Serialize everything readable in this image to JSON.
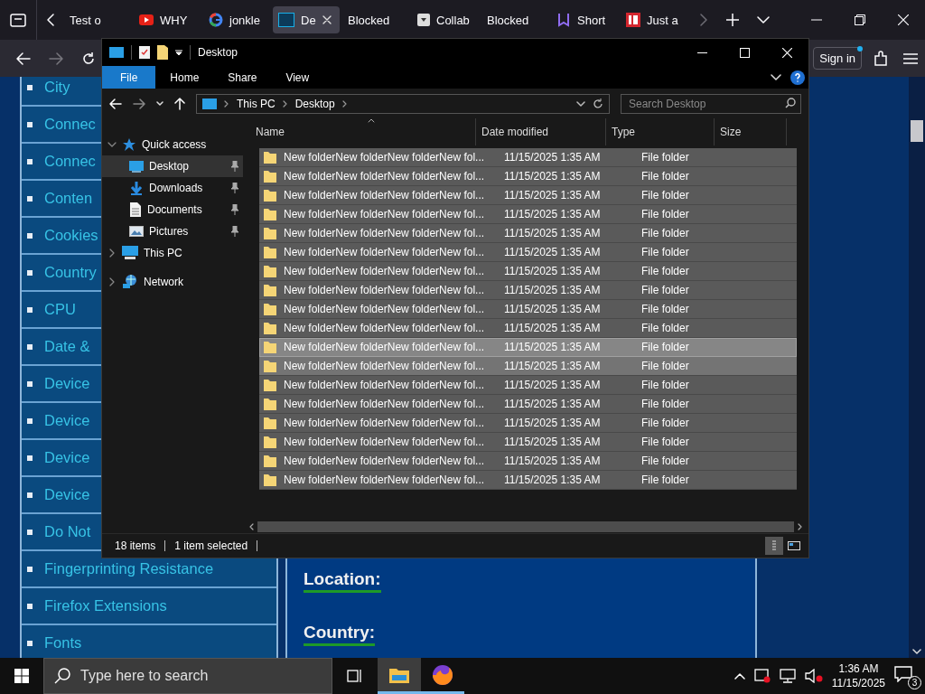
{
  "browser": {
    "tabs": [
      {
        "title": "Test o",
        "kind": "none",
        "selected": false
      },
      {
        "title": "WHY",
        "kind": "video",
        "selected": false
      },
      {
        "title": "jonkle",
        "kind": "google",
        "selected": false
      },
      {
        "title": "De",
        "kind": "square-blue",
        "selected": true
      },
      {
        "title": "Blocked",
        "kind": "none",
        "selected": false
      },
      {
        "title": "Collab",
        "kind": "download",
        "selected": false
      },
      {
        "title": "Blocked",
        "kind": "none",
        "selected": false
      },
      {
        "title": "Short",
        "kind": "bookmark",
        "selected": false
      },
      {
        "title": "Just a",
        "kind": "square-red",
        "selected": false
      }
    ],
    "sign_in": "Sign in",
    "page": {
      "sidebar_items": [
        "City",
        "Connec",
        "Connec",
        "Conten",
        "Cookies",
        "Country",
        "CPU",
        "Date &",
        "Device",
        "Device",
        "Device",
        "Device",
        "Do Not",
        "Fingerprinting Resistance",
        "Firefox Extensions",
        "Fonts"
      ],
      "headings": [
        "Location:",
        "Country:"
      ]
    }
  },
  "explorer": {
    "title": "Desktop",
    "ribbon_tabs": [
      {
        "label": "File",
        "selected": true
      },
      {
        "label": "Home",
        "selected": false
      },
      {
        "label": "Share",
        "selected": false
      },
      {
        "label": "View",
        "selected": false
      }
    ],
    "breadcrumb": [
      "This PC",
      "Desktop"
    ],
    "search": {
      "placeholder": "Search Desktop"
    },
    "nav_pane": [
      {
        "label": "Quick access",
        "kind": "star",
        "expanded": true,
        "selected": false,
        "children": [
          {
            "label": "Desktop",
            "kind": "desktop",
            "pinned": true,
            "selected": true
          },
          {
            "label": "Downloads",
            "kind": "download",
            "pinned": true,
            "selected": false
          },
          {
            "label": "Documents",
            "kind": "document",
            "pinned": true,
            "selected": false
          },
          {
            "label": "Pictures",
            "kind": "pictures",
            "pinned": true,
            "selected": false
          }
        ]
      },
      {
        "label": "This PC",
        "kind": "pc",
        "expanded": false,
        "selected": false
      },
      {
        "label": "Network",
        "kind": "network",
        "expanded": false,
        "selected": false
      }
    ],
    "columns": [
      "Name",
      "Date modified",
      "Type",
      "Size"
    ],
    "rows": [
      {
        "name": "New folderNew folderNew folderNew fol...",
        "date": "11/15/2025 1:35 AM",
        "type": "File folder",
        "selected": false,
        "hover": false
      },
      {
        "name": "New folderNew folderNew folderNew fol...",
        "date": "11/15/2025 1:35 AM",
        "type": "File folder",
        "selected": false,
        "hover": false
      },
      {
        "name": "New folderNew folderNew folderNew fol...",
        "date": "11/15/2025 1:35 AM",
        "type": "File folder",
        "selected": false,
        "hover": false
      },
      {
        "name": "New folderNew folderNew folderNew fol...",
        "date": "11/15/2025 1:35 AM",
        "type": "File folder",
        "selected": false,
        "hover": false
      },
      {
        "name": "New folderNew folderNew folderNew fol...",
        "date": "11/15/2025 1:35 AM",
        "type": "File folder",
        "selected": false,
        "hover": false
      },
      {
        "name": "New folderNew folderNew folderNew fol...",
        "date": "11/15/2025 1:35 AM",
        "type": "File folder",
        "selected": false,
        "hover": false
      },
      {
        "name": "New folderNew folderNew folderNew fol...",
        "date": "11/15/2025 1:35 AM",
        "type": "File folder",
        "selected": false,
        "hover": false
      },
      {
        "name": "New folderNew folderNew folderNew fol...",
        "date": "11/15/2025 1:35 AM",
        "type": "File folder",
        "selected": false,
        "hover": false
      },
      {
        "name": "New folderNew folderNew folderNew fol...",
        "date": "11/15/2025 1:35 AM",
        "type": "File folder",
        "selected": false,
        "hover": false
      },
      {
        "name": "New folderNew folderNew folderNew fol...",
        "date": "11/15/2025 1:35 AM",
        "type": "File folder",
        "selected": false,
        "hover": false
      },
      {
        "name": "New folderNew folderNew folderNew fol...",
        "date": "11/15/2025 1:35 AM",
        "type": "File folder",
        "selected": true,
        "hover": false
      },
      {
        "name": "New folderNew folderNew folderNew fol...",
        "date": "11/15/2025 1:35 AM",
        "type": "File folder",
        "selected": false,
        "hover": true
      },
      {
        "name": "New folderNew folderNew folderNew fol...",
        "date": "11/15/2025 1:35 AM",
        "type": "File folder",
        "selected": false,
        "hover": false
      },
      {
        "name": "New folderNew folderNew folderNew fol...",
        "date": "11/15/2025 1:35 AM",
        "type": "File folder",
        "selected": false,
        "hover": false
      },
      {
        "name": "New folderNew folderNew folderNew fol...",
        "date": "11/15/2025 1:35 AM",
        "type": "File folder",
        "selected": false,
        "hover": false
      },
      {
        "name": "New folderNew folderNew folderNew fol...",
        "date": "11/15/2025 1:35 AM",
        "type": "File folder",
        "selected": false,
        "hover": false
      },
      {
        "name": "New folderNew folderNew folderNew fol...",
        "date": "11/15/2025 1:35 AM",
        "type": "File folder",
        "selected": false,
        "hover": false
      },
      {
        "name": "New folderNew folderNew folderNew fol...",
        "date": "11/15/2025 1:35 AM",
        "type": "File folder",
        "selected": false,
        "hover": false
      }
    ],
    "status_bar": {
      "item_count": "18 items",
      "selection": "1 item selected"
    },
    "view": {
      "details": true,
      "tiles": false
    }
  },
  "taskbar": {
    "search": {
      "placeholder": "Type here to search"
    },
    "apps": [
      {
        "kind": "folder",
        "active": true
      },
      {
        "kind": "fox",
        "active": false
      }
    ],
    "time": "1:36 AM",
    "date": "11/15/2025",
    "notifications": "3"
  }
}
